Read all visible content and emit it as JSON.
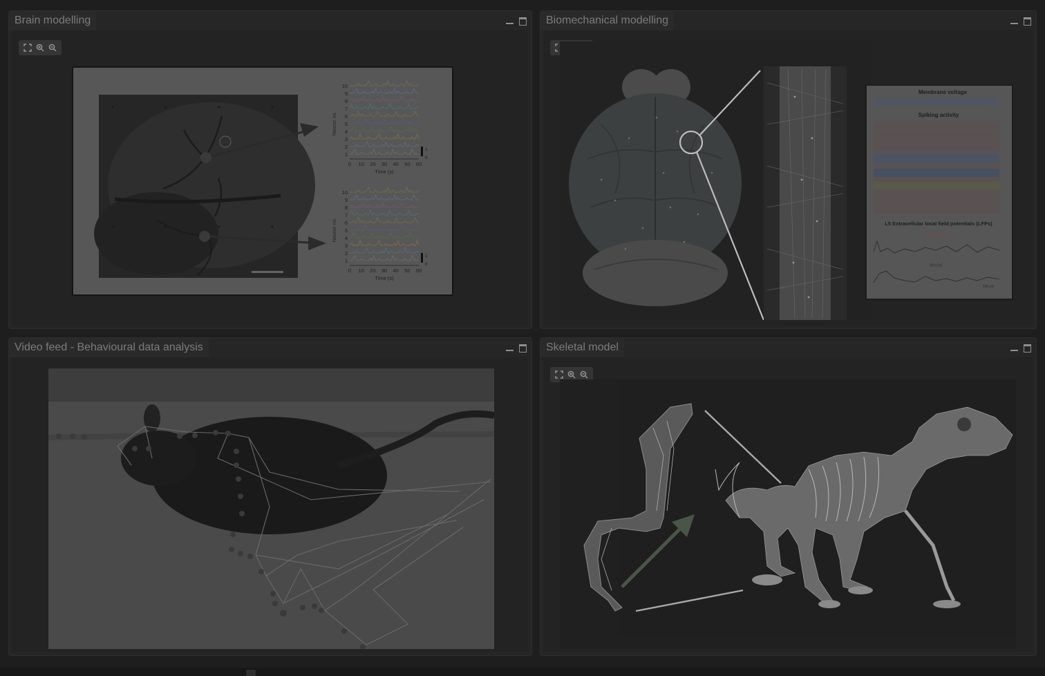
{
  "panels": {
    "brain": {
      "title": "Brain modelling",
      "chart_top": {
        "ylabel": "Neuron no.",
        "xlabel": "Time (s)",
        "yticks": [
          "10",
          "9",
          "8",
          "7",
          "6",
          "5",
          "4",
          "3",
          "2",
          "1"
        ],
        "xticks": [
          "0",
          "10",
          "20",
          "30",
          "40",
          "50",
          "60"
        ],
        "scale_labels": [
          "1",
          "0"
        ]
      },
      "chart_bottom": {
        "ylabel": "Neuron no.",
        "xlabel": "Time (s)",
        "yticks": [
          "10",
          "9",
          "8",
          "7",
          "6",
          "5",
          "4",
          "3",
          "2",
          "1"
        ],
        "xticks": [
          "0",
          "10",
          "20",
          "30",
          "40",
          "50",
          "60"
        ],
        "scale_labels": [
          "1",
          "0"
        ]
      }
    },
    "biomech": {
      "title": "Biomechanical modelling",
      "inset": {
        "membrane_title": "Membrane voltage",
        "spiking_title": "Spiking activity",
        "lfp_title": "L5 Extracellular local field potentials (LFPs)",
        "experiment_label": "Experiment",
        "model_label": "Model",
        "scale_label": "100 μV"
      }
    },
    "video": {
      "title": "Video feed - Behavioural data analysis"
    },
    "skeletal": {
      "title": "Skeletal model"
    }
  },
  "icons": [
    "fit-view-icon",
    "zoom-in-icon",
    "zoom-out-icon",
    "minimize-icon",
    "maximize-icon"
  ],
  "colors": {
    "background": "#1e1e1e",
    "panel": "#262626",
    "tab_text": "#7c7c7c",
    "trace_colors": [
      "#6f6a4f",
      "#5a6b7c",
      "#6a5a6a",
      "#4f6d6a",
      "#6d6a4f",
      "#5a5a7a",
      "#4f6a4f",
      "#7a6a4f",
      "#5a6a7a",
      "#6a6a6a"
    ]
  }
}
